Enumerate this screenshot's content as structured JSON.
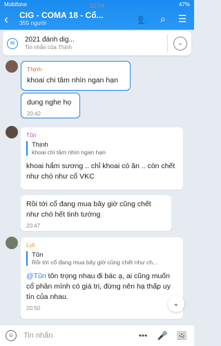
{
  "status": {
    "carrier": "Mobifone",
    "time": "22:14",
    "battery": "47%"
  },
  "header": {
    "title": "CIG - COMA 18 - Cổ...",
    "subtitle": "355 người"
  },
  "pinned": {
    "title": "2021 đánh dig...",
    "subtitle": "Tin nhắn của Thịnh"
  },
  "messages": [
    {
      "sender": "Thịnh",
      "sender_color": "#e0683f",
      "text": "khoai chi tâm nhìn ngan hạn"
    },
    {
      "text": "dung nghe họ",
      "time": "20:42"
    },
    {
      "sender": "Tũn",
      "sender_color": "#c54cb9",
      "quote_name": "Thịnh",
      "quote_text": "khoai chi tâm nhìn ngan hạn",
      "text": "khoai hẩm sương .. chỉ khoai có ăn .. còn chết như chó như cổ VKC"
    },
    {
      "text": "Rồi tới cổ đang mua bây giờ cũng chết như chó hết tinh tướng",
      "time": "20:47"
    },
    {
      "sender": "Lyli",
      "sender_color": "#e49a2e",
      "quote_name": "Tũn",
      "quote_text": "Rồi tới cổ đang mua bây giờ cũng chết như ch...",
      "mention": "@Tũn",
      "text": " tôn trọng nhau đi bác ạ, ai cũng muốn cổ phần mình có giá trị, đừng nên hạ thấp uy tín của nhau.",
      "time": "20:50"
    }
  ],
  "composer": {
    "placeholder": "Tin nhắn"
  },
  "icons": [
    "back-icon",
    "add-member-icon",
    "search-icon",
    "menu-icon",
    "pinned-message-icon",
    "chevron-down-icon",
    "emoji-icon",
    "more-icon",
    "mic-icon",
    "image-icon",
    "scroll-down-icon"
  ]
}
